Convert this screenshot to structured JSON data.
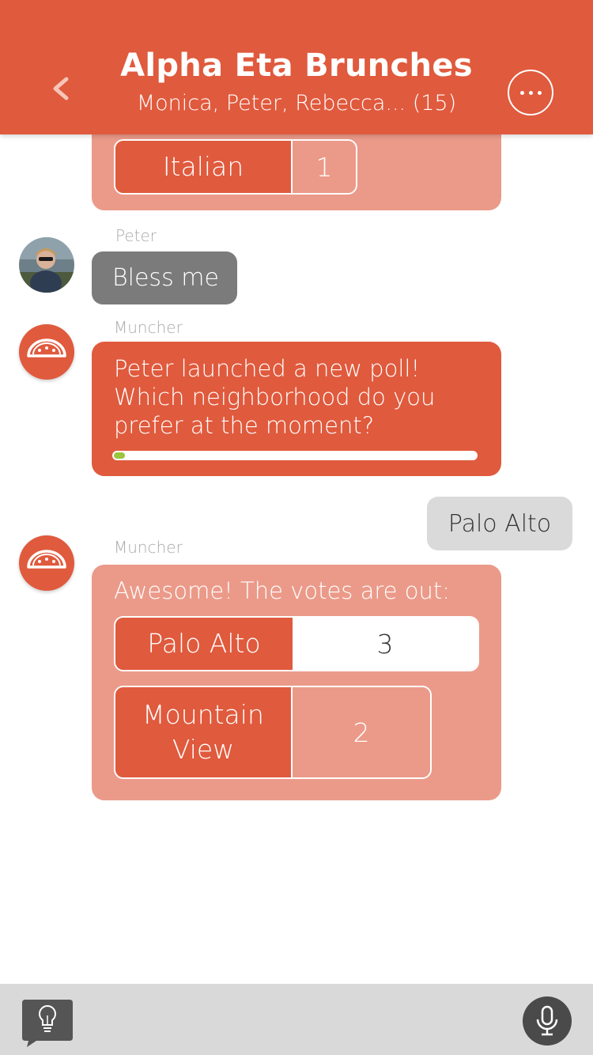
{
  "header": {
    "title": "Alpha Eta Brunches",
    "subtitle": "Monica, Peter, Rebecca... (15)",
    "back_icon": "chevron-left-icon",
    "more_icon": "ellipsis-icon"
  },
  "top_card": {
    "option": {
      "label": "Italian",
      "count": "1"
    }
  },
  "messages": {
    "peter": {
      "sender": "Peter",
      "text": "Bless me"
    },
    "poll": {
      "sender": "Muncher",
      "text": "Peter launched a new poll! Which neighborhood do you prefer at the moment?",
      "progress_percent": 3
    },
    "mine": {
      "text": "Palo Alto"
    },
    "results": {
      "sender": "Muncher",
      "intro": "Awesome! The votes are out:",
      "options": [
        {
          "label": "Palo Alto",
          "count": "3"
        },
        {
          "label": "Mountain View",
          "count": "2"
        }
      ]
    }
  },
  "footer": {
    "tip_icon": "lightbulb-icon",
    "mic_icon": "microphone-icon"
  },
  "colors": {
    "accent": "#e05a3d",
    "card": "#eb9a89",
    "gray_bubble": "#7b7b7b",
    "my_bubble": "#dadada",
    "progress": "#9bc53d"
  }
}
